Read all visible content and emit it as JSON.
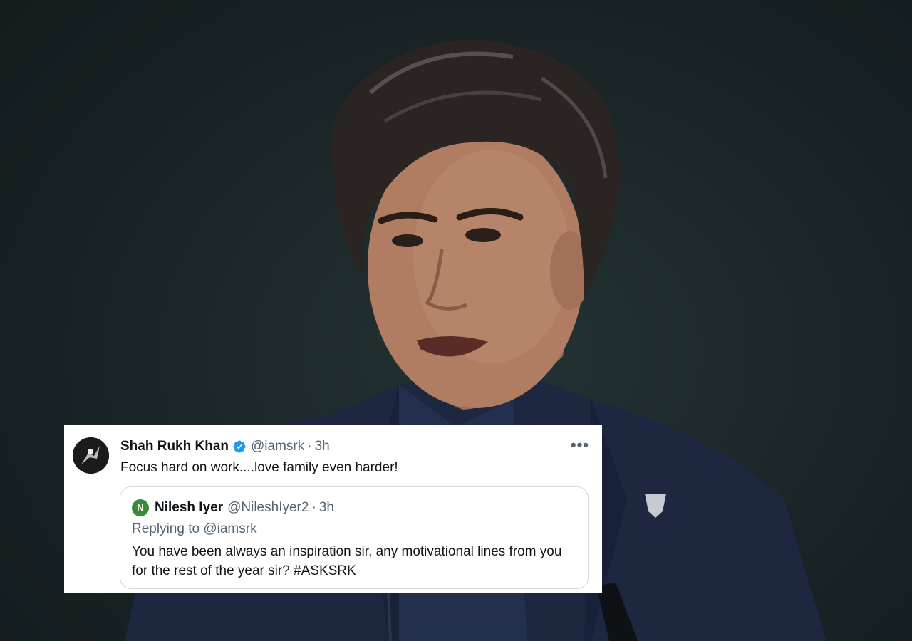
{
  "tweet": {
    "author_name": "Shah Rukh Khan",
    "author_handle": "@iamsrk",
    "separator": "·",
    "time": "3h",
    "more_label": "•••",
    "text": "Focus hard on work....love family even harder!",
    "verified_icon": "verified-badge-icon",
    "quote": {
      "avatar_letter": "N",
      "author_name": "Nilesh Iyer",
      "author_handle": "@NileshIyer2",
      "separator": "·",
      "time": "3h",
      "replying_prefix": "Replying to",
      "replying_handle": "@iamsrk",
      "text": "You have been always an inspiration sir, any motivational lines from you for the rest of the year sir? #ASKSRK"
    }
  },
  "colors": {
    "card_bg": "#ffffff",
    "text_primary": "#0f1419",
    "text_secondary": "#536471",
    "verified_blue": "#1d9bf0",
    "quote_border": "#cfd9de",
    "photo_background": "#1e2a2c"
  }
}
